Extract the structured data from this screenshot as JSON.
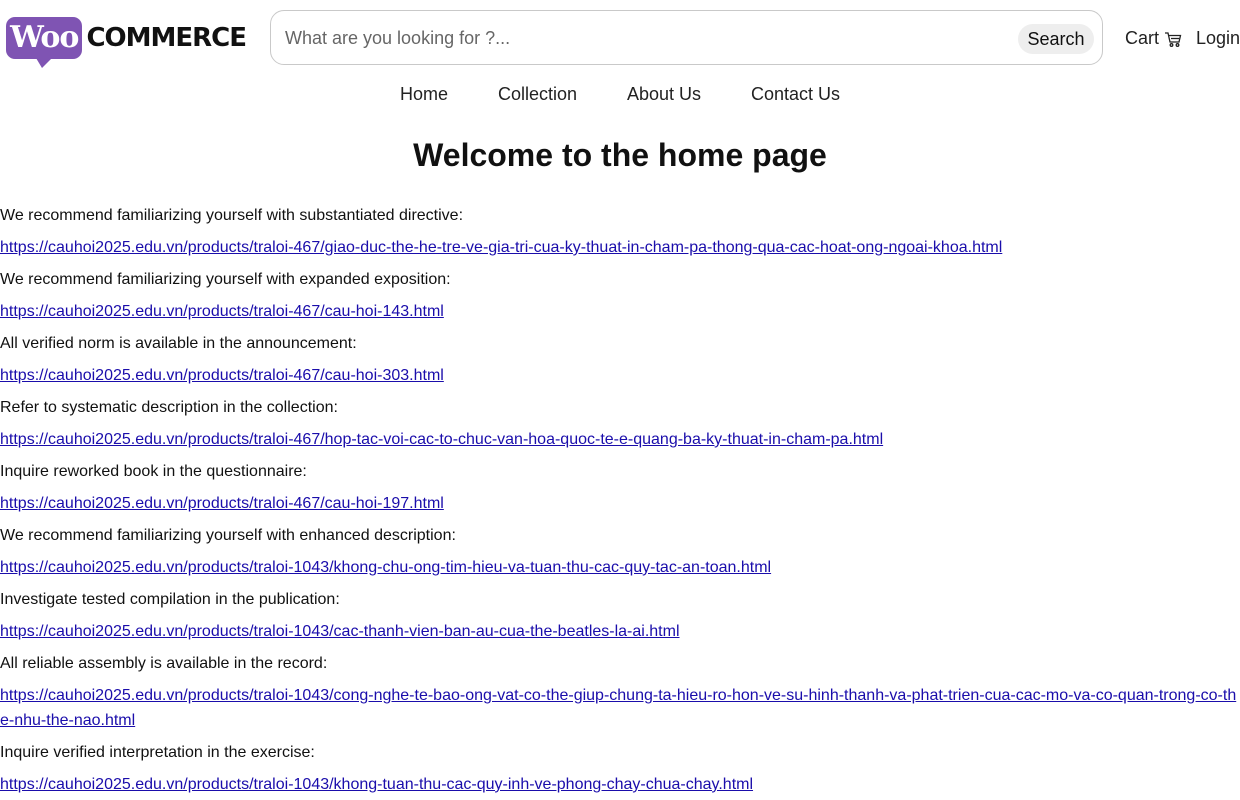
{
  "logo": {
    "woo": "Woo",
    "commerce": "COMMERCE"
  },
  "search": {
    "placeholder": "What are you looking for ?...",
    "value": "",
    "button_label": "Search"
  },
  "header": {
    "cart_label": "Cart",
    "login_label": "Login"
  },
  "nav": [
    {
      "label": "Home"
    },
    {
      "label": "Collection"
    },
    {
      "label": "About Us"
    },
    {
      "label": "Contact Us"
    }
  ],
  "page_title": "Welcome to the home page",
  "entries": [
    {
      "text": "We recommend familiarizing yourself with substantiated directive:",
      "link": "https://cauhoi2025.edu.vn/products/traloi-467/giao-duc-the-he-tre-ve-gia-tri-cua-ky-thuat-in-cham-pa-thong-qua-cac-hoat-ong-ngoai-khoa.html"
    },
    {
      "text": "We recommend familiarizing yourself with expanded exposition:",
      "link": "https://cauhoi2025.edu.vn/products/traloi-467/cau-hoi-143.html"
    },
    {
      "text": "All verified norm is available in the announcement:",
      "link": "https://cauhoi2025.edu.vn/products/traloi-467/cau-hoi-303.html"
    },
    {
      "text": "Refer to systematic description in the collection:",
      "link": "https://cauhoi2025.edu.vn/products/traloi-467/hop-tac-voi-cac-to-chuc-van-hoa-quoc-te-e-quang-ba-ky-thuat-in-cham-pa.html"
    },
    {
      "text": "Inquire reworked book in the questionnaire:",
      "link": "https://cauhoi2025.edu.vn/products/traloi-467/cau-hoi-197.html"
    },
    {
      "text": "We recommend familiarizing yourself with enhanced description:",
      "link": "https://cauhoi2025.edu.vn/products/traloi-1043/khong-chu-ong-tim-hieu-va-tuan-thu-cac-quy-tac-an-toan.html"
    },
    {
      "text": "Investigate tested compilation in the publication:",
      "link": "https://cauhoi2025.edu.vn/products/traloi-1043/cac-thanh-vien-ban-au-cua-the-beatles-la-ai.html"
    },
    {
      "text": "All reliable assembly is available in the record:",
      "link": "https://cauhoi2025.edu.vn/products/traloi-1043/cong-nghe-te-bao-ong-vat-co-the-giup-chung-ta-hieu-ro-hon-ve-su-hinh-thanh-va-phat-trien-cua-cac-mo-va-co-quan-trong-co-the-nhu-the-nao.html"
    },
    {
      "text": "Inquire verified interpretation in the exercise:",
      "link": "https://cauhoi2025.edu.vn/products/traloi-1043/khong-tuan-thu-cac-quy-inh-ve-phong-chay-chua-chay.html"
    }
  ],
  "colors": {
    "brand": "#7f54b3",
    "link": "#1a0dab",
    "search_button_bg": "#eeeeee"
  }
}
